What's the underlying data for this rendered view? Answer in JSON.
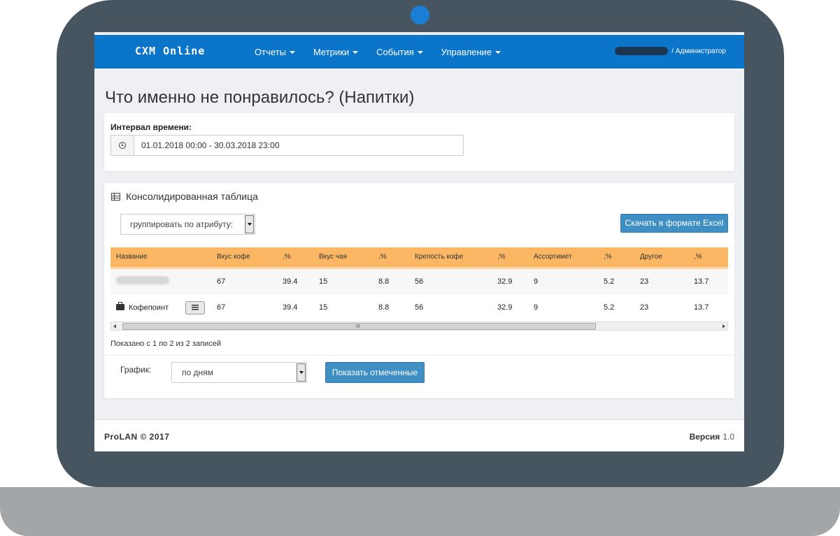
{
  "navbar": {
    "brand": "CXM Online",
    "menu": [
      {
        "label": "Отчеты"
      },
      {
        "label": "Метрики"
      },
      {
        "label": "События"
      },
      {
        "label": "Управление"
      }
    ],
    "user_role": "/ Администратор"
  },
  "page": {
    "title": "Что именно не понравилось? (Напитки)"
  },
  "interval": {
    "label": "Интервал времени:",
    "value": "01.01.2018 00:00 - 30.03.2018 23:00"
  },
  "table_panel": {
    "heading": "Консолидированная таблица",
    "group_select_value": "группировать по атрибуту:",
    "excel_button": "Скачать в формате Excel",
    "columns": [
      "Название",
      "Вкус кофе",
      ",%",
      "Вкус чая",
      ",%",
      "Крепость кофе",
      ",%",
      "Ассортимет",
      ",%",
      "Другое",
      ",%"
    ],
    "rows": [
      {
        "name": "",
        "values": [
          "67",
          "39.4",
          "15",
          "8.8",
          "56",
          "32.9",
          "9",
          "5.2",
          "23",
          "13.7"
        ]
      },
      {
        "name": "Кофепоинт",
        "values": [
          "67",
          "39.4",
          "15",
          "8.8",
          "56",
          "32.9",
          "9",
          "5.2",
          "23",
          "13.7"
        ]
      }
    ],
    "scroll_grip": "III",
    "records_info": "Показано с 1 по 2 из 2 записей",
    "chart_label": "График:",
    "chart_select_value": "по дням",
    "show_button": "Показать отмеченные"
  },
  "footer": {
    "copyright": "ProLAN © 2017",
    "version_label": "Версия",
    "version_value": "1.0"
  },
  "colors": {
    "navbar": "#0a75c9",
    "table_header": "#fbb764",
    "button": "#3f8fc4",
    "laptop_frame": "#465560"
  }
}
